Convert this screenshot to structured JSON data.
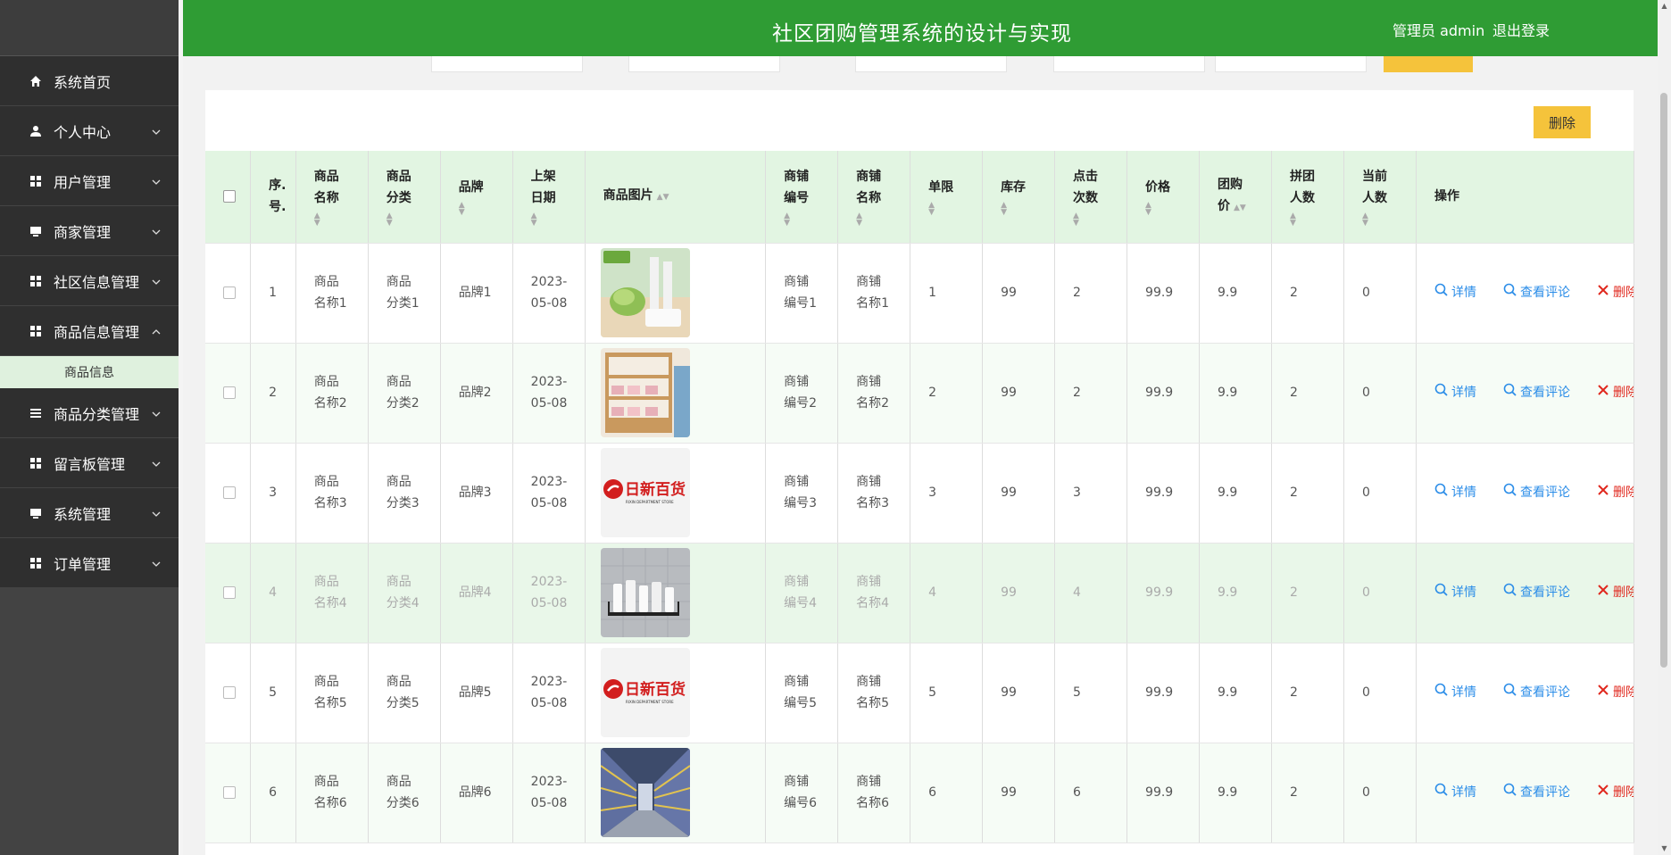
{
  "header": {
    "title": "社区团购管理系统的设计与实现",
    "user": "管理员 admin",
    "logout": "退出登录"
  },
  "sidebar": {
    "items": [
      {
        "label": "系统首页",
        "icon": "home-icon",
        "expandable": false
      },
      {
        "label": "个人中心",
        "icon": "user-icon",
        "expandable": true
      },
      {
        "label": "用户管理",
        "icon": "grid-icon",
        "expandable": true
      },
      {
        "label": "商家管理",
        "icon": "monitor-icon",
        "expandable": true
      },
      {
        "label": "社区信息管理",
        "icon": "grid-icon",
        "expandable": true
      },
      {
        "label": "商品信息管理",
        "icon": "grid-icon",
        "expandable": true,
        "open": true
      },
      {
        "label": "商品分类管理",
        "icon": "list-icon",
        "expandable": true
      },
      {
        "label": "留言板管理",
        "icon": "grid-icon",
        "expandable": true
      },
      {
        "label": "系统管理",
        "icon": "monitor-icon",
        "expandable": true
      },
      {
        "label": "订单管理",
        "icon": "grid-icon",
        "expandable": true
      }
    ],
    "sub_item": "商品信息"
  },
  "toolbar": {
    "delete_label": "删除"
  },
  "table": {
    "headers": {
      "index": [
        "序.",
        "号."
      ],
      "name": [
        "商品",
        "名称"
      ],
      "category": [
        "商品",
        "分类"
      ],
      "brand": [
        "品牌"
      ],
      "date": [
        "上架",
        "日期"
      ],
      "image": [
        "商品图片"
      ],
      "shop_no": [
        "商铺",
        "编号"
      ],
      "shop_name": [
        "商铺",
        "名称"
      ],
      "limit": [
        "单限"
      ],
      "stock": [
        "库存"
      ],
      "clicks": [
        "点击",
        "次数"
      ],
      "price": [
        "价格"
      ],
      "group_price": [
        "团购",
        "价"
      ],
      "group_people": [
        "拼团",
        "人数"
      ],
      "current_people": [
        "当前",
        "人数"
      ],
      "actions": [
        "操作"
      ]
    },
    "ops": {
      "detail": "详情",
      "comment": "查看评论",
      "delete": "删除"
    },
    "rows": [
      {
        "index": "1",
        "name": [
          "商品",
          "名称1"
        ],
        "category": [
          "商品",
          "分类1"
        ],
        "brand": "品牌1",
        "date": [
          "2023-",
          "05-08"
        ],
        "image": "wrap-film",
        "shop_no": [
          "商铺",
          "编号1"
        ],
        "shop_name": [
          "商铺",
          "名称1"
        ],
        "limit": "1",
        "stock": "99",
        "clicks": "2",
        "price": "99.9",
        "group_price": "9.9",
        "group_people": "2",
        "current_people": "0"
      },
      {
        "index": "2",
        "name": [
          "商品",
          "名称2"
        ],
        "category": [
          "商品",
          "分类2"
        ],
        "brand": "品牌2",
        "date": [
          "2023-",
          "05-08"
        ],
        "image": "shoe-rack",
        "shop_no": [
          "商铺",
          "编号2"
        ],
        "shop_name": [
          "商铺",
          "名称2"
        ],
        "limit": "2",
        "stock": "99",
        "clicks": "2",
        "price": "99.9",
        "group_price": "9.9",
        "group_people": "2",
        "current_people": "0"
      },
      {
        "index": "3",
        "name": [
          "商品",
          "名称3"
        ],
        "category": [
          "商品",
          "分类3"
        ],
        "brand": "品牌3",
        "date": [
          "2023-",
          "05-08"
        ],
        "image": "store-logo",
        "shop_no": [
          "商铺",
          "编号3"
        ],
        "shop_name": [
          "商铺",
          "名称3"
        ],
        "limit": "3",
        "stock": "99",
        "clicks": "3",
        "price": "99.9",
        "group_price": "9.9",
        "group_people": "2",
        "current_people": "0"
      },
      {
        "index": "4",
        "name": [
          "商品",
          "名称4"
        ],
        "category": [
          "商品",
          "分类4"
        ],
        "brand": "品牌4",
        "date": [
          "2023-",
          "05-08"
        ],
        "image": "bath-shelf",
        "shop_no": [
          "商铺",
          "编号4"
        ],
        "shop_name": [
          "商铺",
          "名称4"
        ],
        "limit": "4",
        "stock": "99",
        "clicks": "4",
        "price": "99.9",
        "group_price": "9.9",
        "group_people": "2",
        "current_people": "0"
      },
      {
        "index": "5",
        "name": [
          "商品",
          "名称5"
        ],
        "category": [
          "商品",
          "分类5"
        ],
        "brand": "品牌5",
        "date": [
          "2023-",
          "05-08"
        ],
        "image": "store-logo",
        "shop_no": [
          "商铺",
          "编号5"
        ],
        "shop_name": [
          "商铺",
          "名称5"
        ],
        "limit": "5",
        "stock": "99",
        "clicks": "5",
        "price": "99.9",
        "group_price": "9.9",
        "group_people": "2",
        "current_people": "0"
      },
      {
        "index": "6",
        "name": [
          "商品",
          "名称6"
        ],
        "category": [
          "商品",
          "分类6"
        ],
        "brand": "品牌6",
        "date": [
          "2023-",
          "05-08"
        ],
        "image": "supermarket-aisle",
        "shop_no": [
          "商铺",
          "编号6"
        ],
        "shop_name": [
          "商铺",
          "名称6"
        ],
        "limit": "6",
        "stock": "99",
        "clicks": "6",
        "price": "99.9",
        "group_price": "9.9",
        "group_people": "2",
        "current_people": "0"
      }
    ],
    "store_logo_text": "日新百货",
    "store_logo_sub": "RIXIN DEPARTMENT STORE"
  },
  "colors": {
    "header_green": "#2f9c34",
    "sidebar_dark": "#2f2f2f",
    "accent_yellow": "#f5c33b",
    "link_blue": "#2b8de8",
    "delete_red": "#e0281e",
    "header_row": "#e2f5e2"
  }
}
